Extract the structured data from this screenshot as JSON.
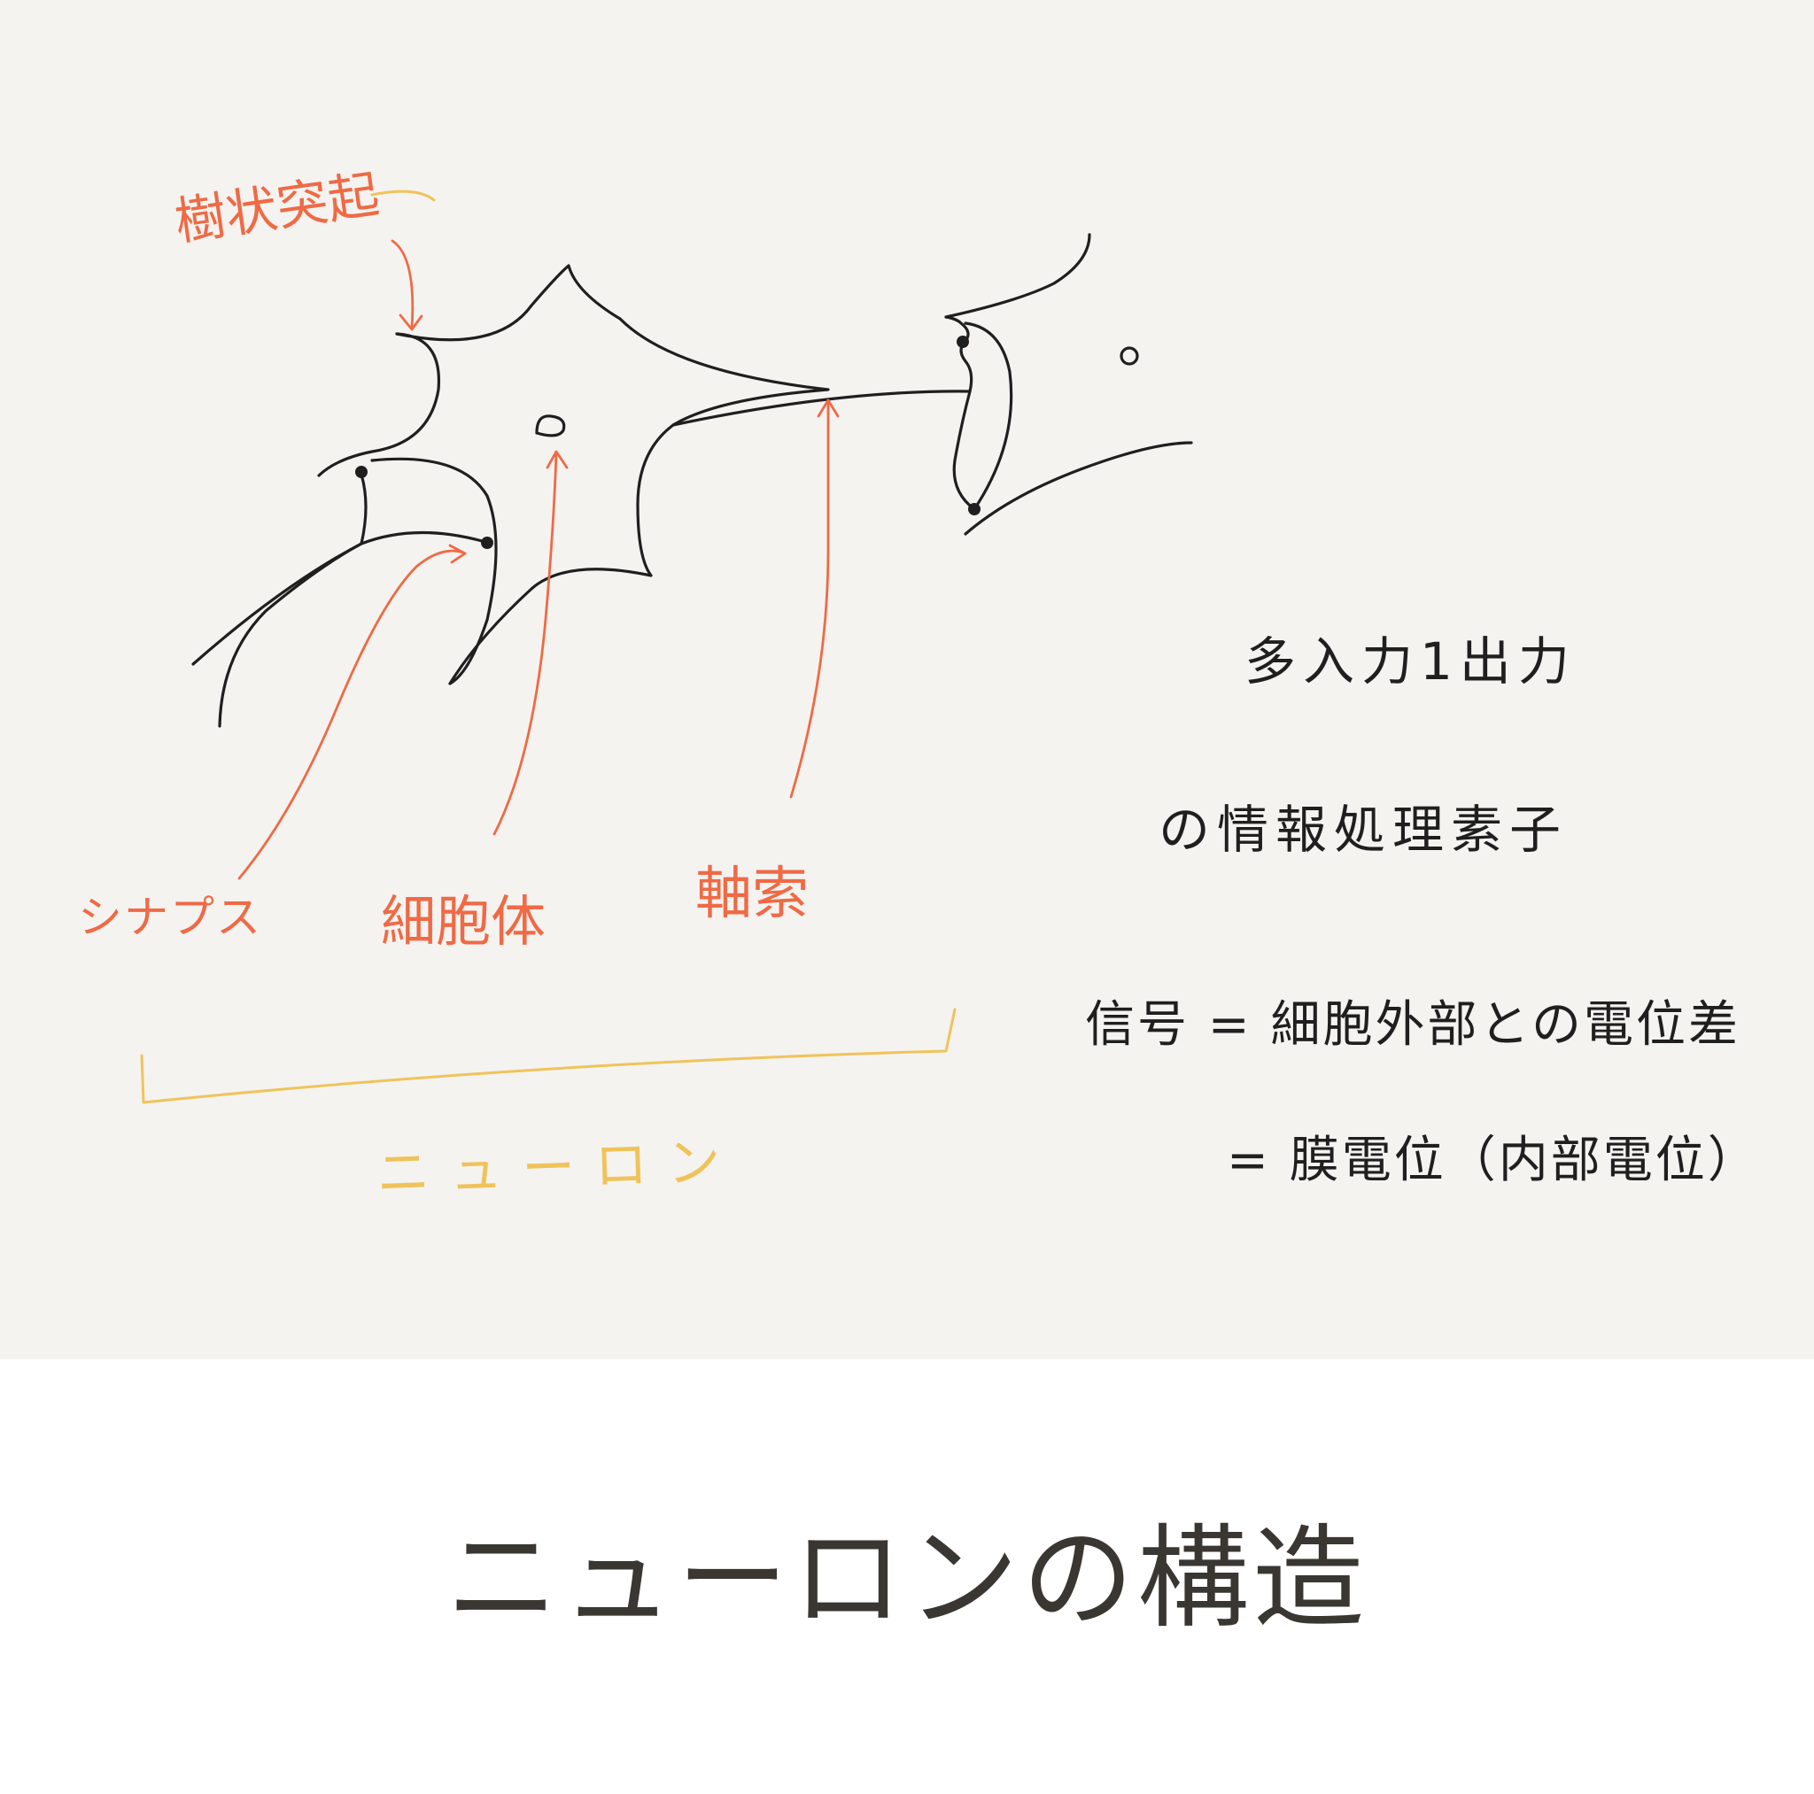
{
  "colors": {
    "background": "#f4f3f0",
    "ink": "#1f1f1f",
    "label_red": "#ef6a45",
    "bracket_yellow": "#f0c35a",
    "caption": "#3a3632"
  },
  "labels": {
    "dendrite": "樹状突起",
    "synapse": "シナプス",
    "cell_body": "細胞体",
    "axon": "軸索",
    "neuron": "ニューロン"
  },
  "notes": {
    "line1": "多入力1出力",
    "line2": "の情報処理素子",
    "line3": "信号 = 細胞外部との電位差",
    "line4": "= 膜電位（内部電位）"
  },
  "caption": "ニューロンの構造"
}
